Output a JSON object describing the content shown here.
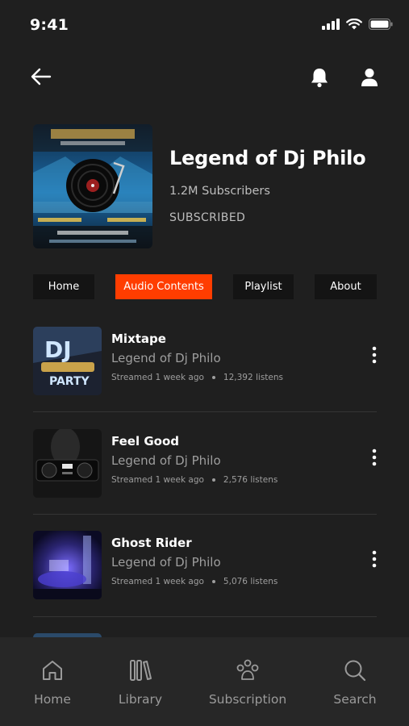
{
  "status_bar": {
    "time": "9:41"
  },
  "channel": {
    "name": "Legend of Dj Philo",
    "subscribers": "1.2M Subscribers",
    "status": "SUBSCRIBED",
    "cover_icon": "dj-turntable-artwork"
  },
  "tabs": [
    {
      "label": "Home",
      "active": false
    },
    {
      "label": "Audio Contents",
      "active": true
    },
    {
      "label": "Playlist",
      "active": false
    },
    {
      "label": "About",
      "active": false
    }
  ],
  "tracks": [
    {
      "title": "Mixtape",
      "artist": "Legend of Dj Philo",
      "streamed": "Streamed 1 week ago",
      "listens": "12,392 listens"
    },
    {
      "title": "Feel Good",
      "artist": "Legend of Dj Philo",
      "streamed": "Streamed 1 week ago",
      "listens": "2,576 listens"
    },
    {
      "title": "Ghost Rider",
      "artist": "Legend of Dj Philo",
      "streamed": "Streamed 1 week ago",
      "listens": "5,076 listens"
    }
  ],
  "bottom_nav": [
    {
      "label": "Home",
      "icon": "home-icon"
    },
    {
      "label": "Library",
      "icon": "library-icon"
    },
    {
      "label": "Subscription",
      "icon": "subscription-icon"
    },
    {
      "label": "Search",
      "icon": "search-icon"
    }
  ],
  "colors": {
    "background": "#1f1f1f",
    "accent": "#ff3d00",
    "nav_background": "#272727",
    "muted_text": "#9e9e9e"
  }
}
